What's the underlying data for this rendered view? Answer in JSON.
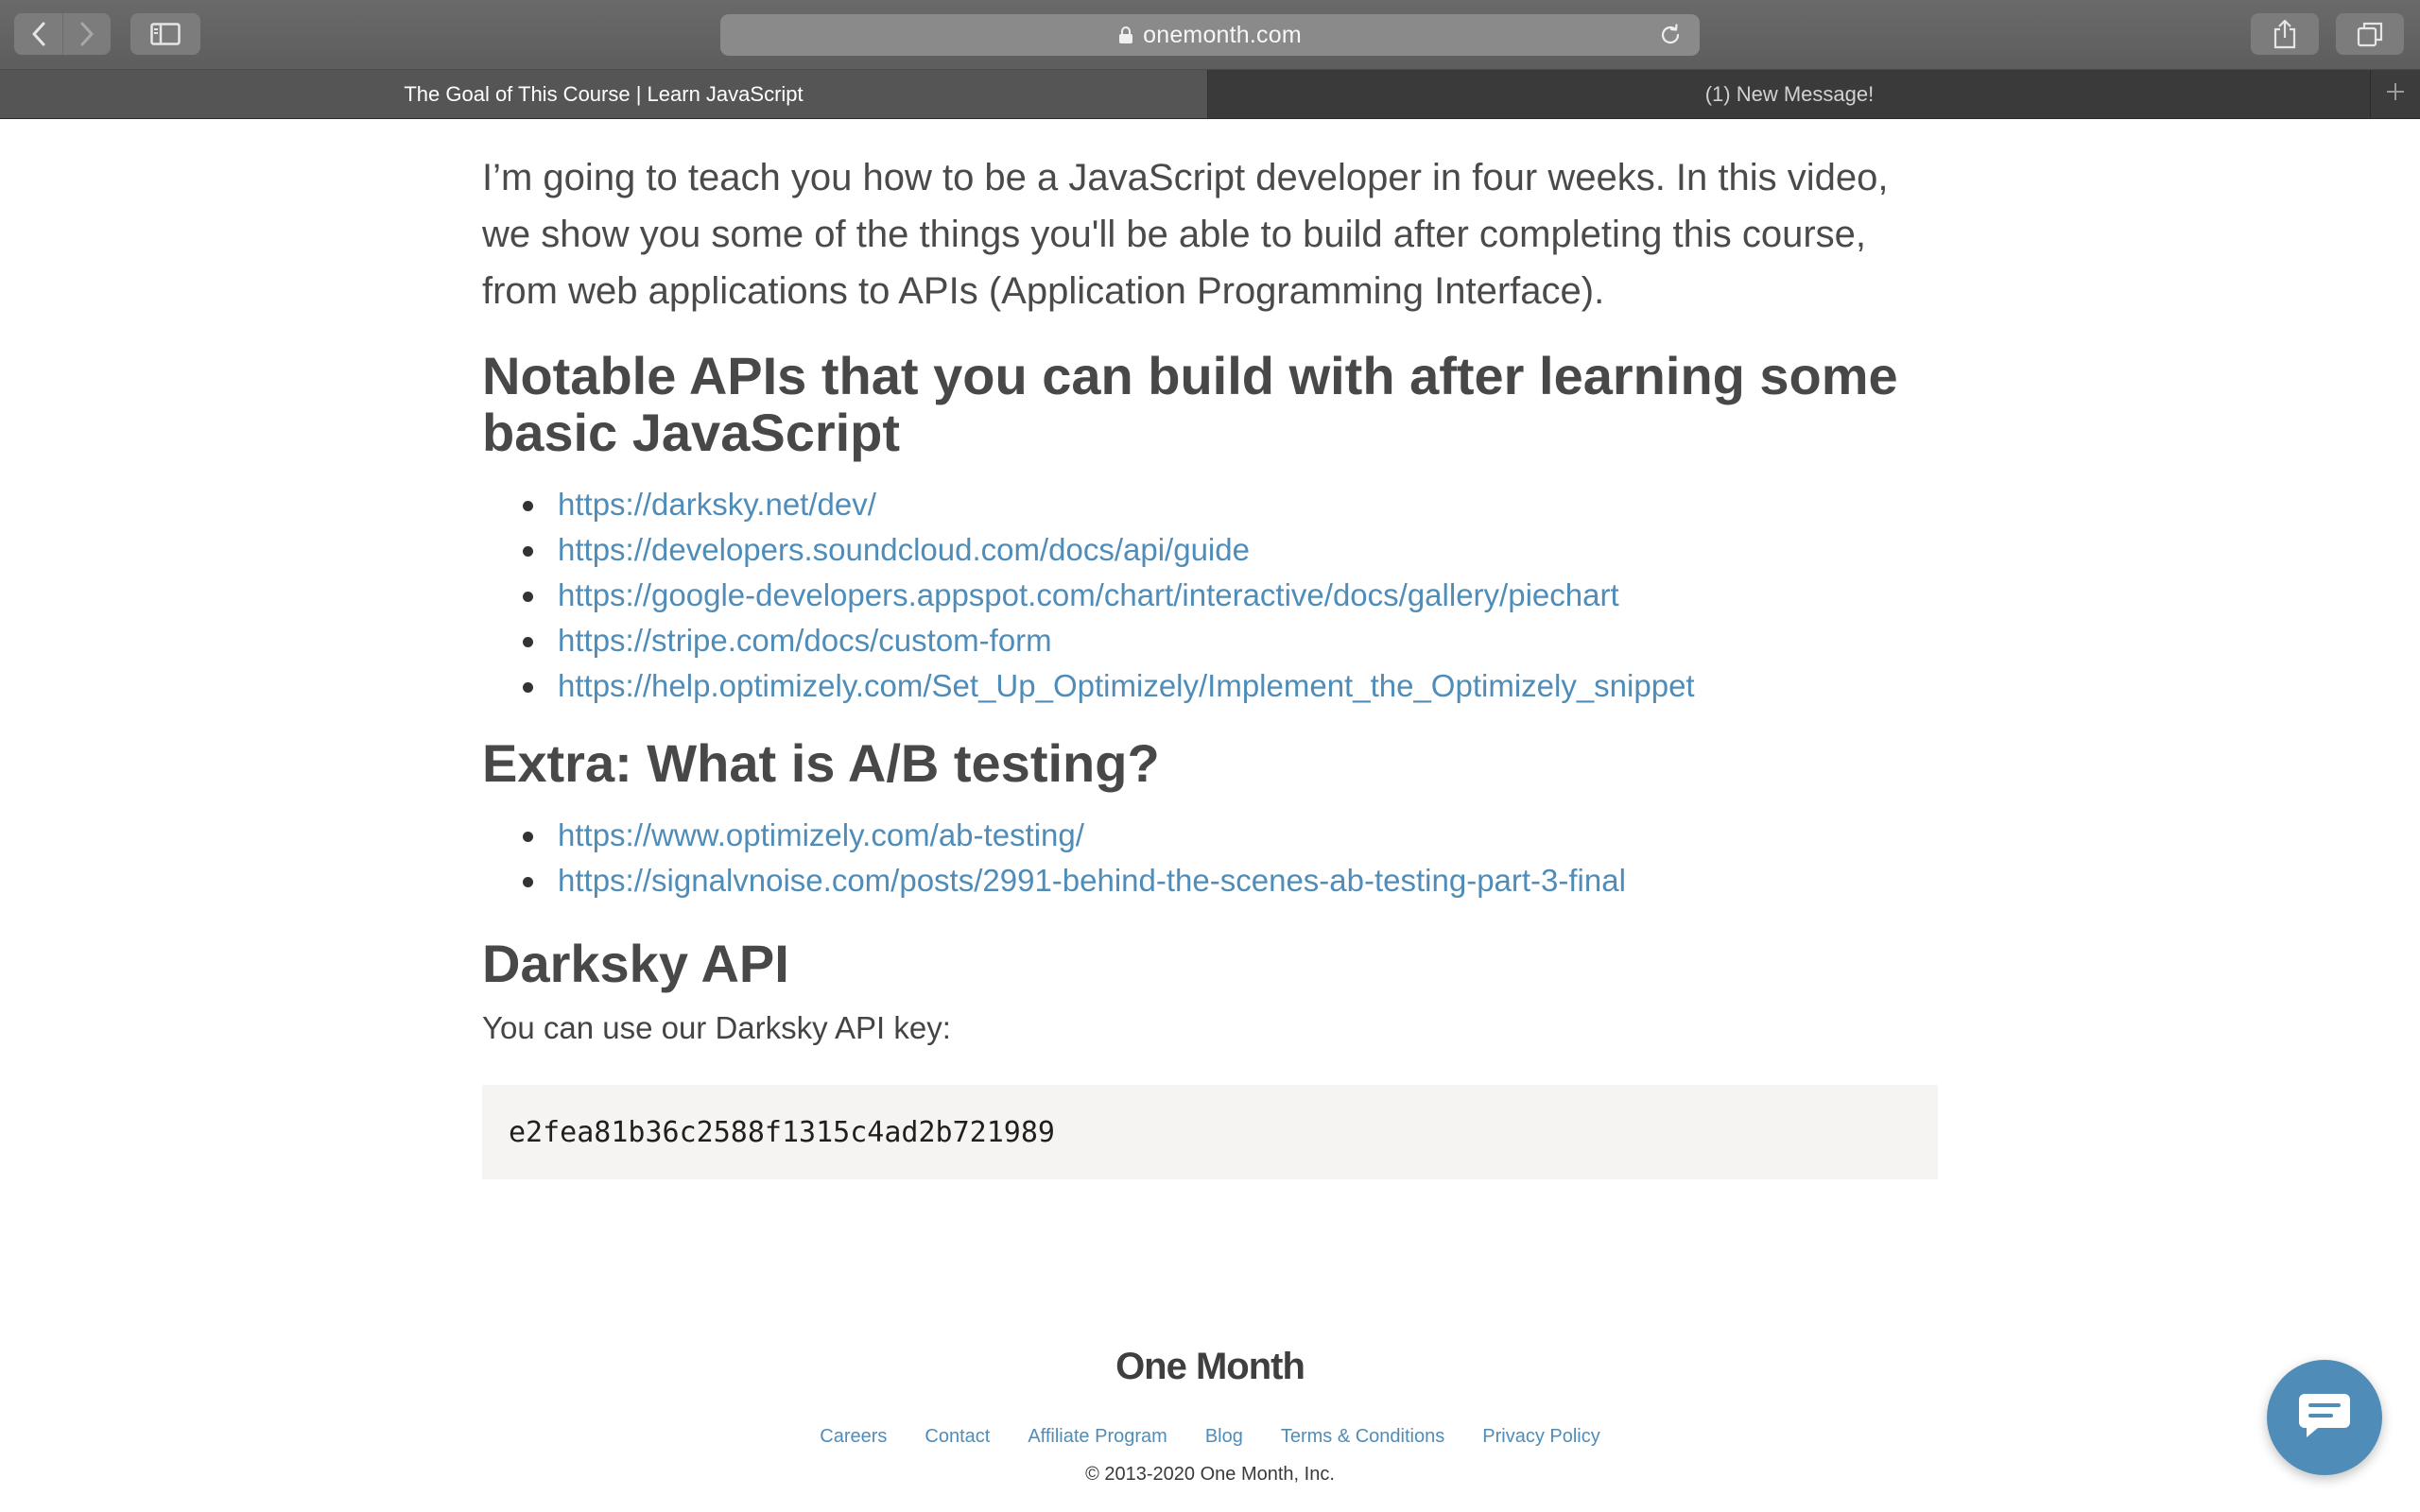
{
  "browser": {
    "url": "onemonth.com",
    "tabs": [
      {
        "title": "The Goal of This Course | Learn JavaScript",
        "active": true
      },
      {
        "title": "(1) New Message!",
        "active": false
      }
    ],
    "icons": {
      "back": "chevron-left-icon",
      "forward": "chevron-right-icon",
      "sidebar": "sidebar-icon",
      "lock": "lock-icon",
      "reload": "reload-icon",
      "share": "share-icon",
      "tabs_overview": "tabs-overview-icon",
      "new_tab": "plus-icon"
    }
  },
  "main": {
    "intro": "I’m going to teach you how to be a JavaScript developer in four weeks. In this video, we show you some of the things you'll be able to build after completing this course, from web applications to APIs (Application Programming Interface).",
    "sections": [
      {
        "heading": "Notable APIs that you can build with after learning some basic JavaScript",
        "links": [
          "https://darksky.net/dev/",
          "https://developers.soundcloud.com/docs/api/guide",
          "https://google-developers.appspot.com/chart/interactive/docs/gallery/piechart",
          "https://stripe.com/docs/custom-form",
          "https://help.optimizely.com/Set_Up_Optimizely/Implement_the_Optimizely_snippet"
        ]
      },
      {
        "heading": "Extra: What is A/B testing?",
        "links": [
          "https://www.optimizely.com/ab-testing/",
          "https://signalvnoise.com/posts/2991-behind-the-scenes-ab-testing-part-3-final"
        ]
      },
      {
        "heading": "Darksky API",
        "text": "You can use our Darksky API key:",
        "code": "e2fea81b36c2588f1315c4ad2b721989"
      }
    ]
  },
  "footer": {
    "logo": "One Month",
    "links": [
      "Careers",
      "Contact",
      "Affiliate Program",
      "Blog",
      "Terms & Conditions",
      "Privacy Policy"
    ],
    "copyright": "© 2013-2020 One Month, Inc."
  },
  "chat": {
    "icon": "chat-icon"
  },
  "colors": {
    "link": "#4f8db8",
    "heading": "#484848",
    "body_text": "#4a4a4a",
    "code_bg": "#f6f4f2",
    "chat_bubble": "#4f8db8"
  }
}
